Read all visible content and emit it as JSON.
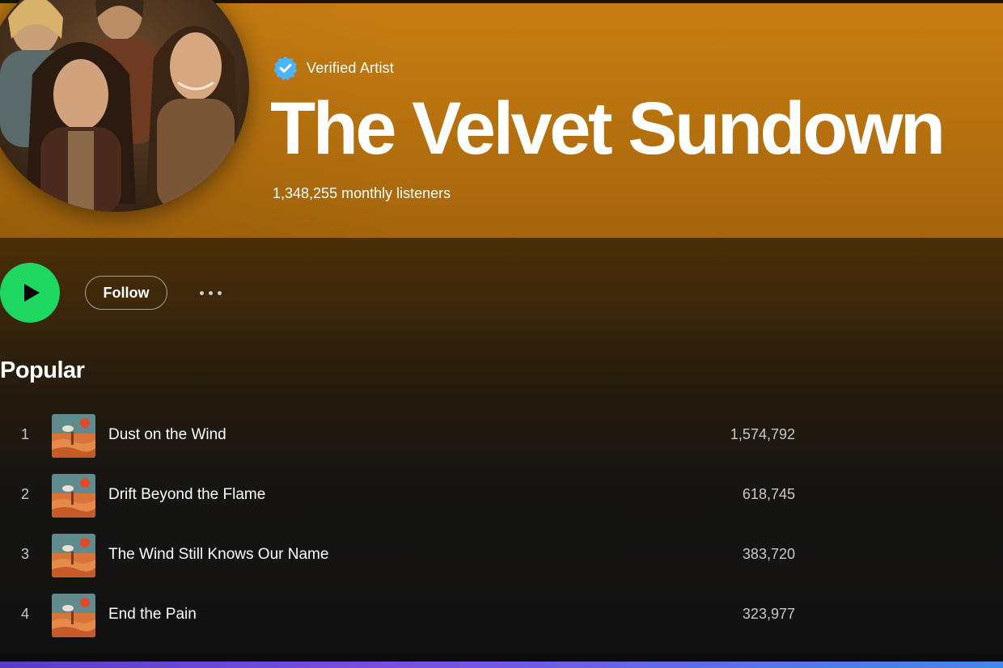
{
  "artist": {
    "verified_label": "Verified Artist",
    "name": "The Velvet Sundown",
    "monthly_listeners": "1,348,255 monthly listeners"
  },
  "actions": {
    "follow_label": "Follow"
  },
  "popular": {
    "title": "Popular",
    "tracks": [
      {
        "number": "1",
        "title": "Dust on the Wind",
        "plays": "1,574,792"
      },
      {
        "number": "2",
        "title": "Drift Beyond the Flame",
        "plays": "618,745"
      },
      {
        "number": "3",
        "title": "The Wind Still Knows Our Name",
        "plays": "383,720"
      },
      {
        "number": "4",
        "title": "End the Pain",
        "plays": "323,977"
      }
    ]
  },
  "colors": {
    "hero": "#c77d12",
    "play_button": "#1ed760",
    "verified_badge": "#4cb3ff",
    "background": "#121212"
  },
  "icons": [
    "verified-badge-icon",
    "play-icon",
    "more-options-icon"
  ]
}
